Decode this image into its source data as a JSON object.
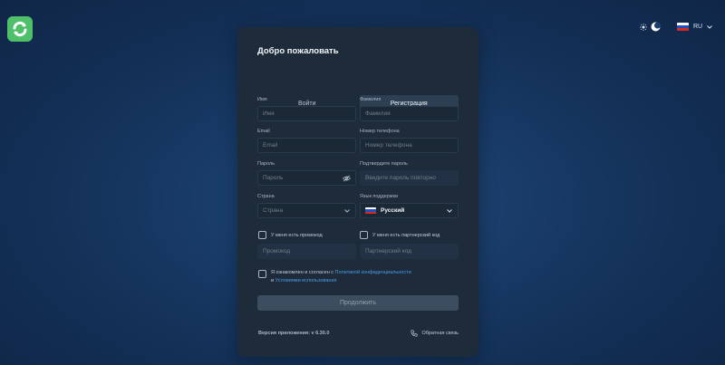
{
  "header": {
    "logo_icon": "refresh-arrows-logo",
    "brand_color": "#4fbf6a",
    "theme_icons": [
      "sun-icon",
      "moon-icon"
    ],
    "language": {
      "code": "RU",
      "flag": "russia-flag-icon"
    }
  },
  "card": {
    "title": "Добро пожаловать",
    "tabs": [
      {
        "label": "Войти",
        "active": false
      },
      {
        "label": "Регистрация",
        "active": true
      }
    ],
    "fields": {
      "first_name": {
        "label": "Имя",
        "placeholder": "Имя"
      },
      "last_name": {
        "label": "Фамилия",
        "placeholder": "Фамилия"
      },
      "email": {
        "label": "Email",
        "placeholder": "Email"
      },
      "phone": {
        "label": "Номер телефона",
        "placeholder": "Номер телефона"
      },
      "password": {
        "label": "Пароль",
        "placeholder": "Пароль"
      },
      "confirm_password": {
        "label": "Подтвердите пароль",
        "placeholder": "Введите пароль повторно"
      },
      "country": {
        "label": "Страна",
        "placeholder": "Страна"
      },
      "support_language": {
        "label": "Язык поддержки",
        "value": "Русский"
      }
    },
    "promo": {
      "checkbox_label": "У меня есть промокод",
      "placeholder": "Промокод"
    },
    "partner": {
      "checkbox_label": "У меня есть партнерский код",
      "placeholder": "Партнерский код"
    },
    "agreement": {
      "prefix": "Я ознакомлен и согласен с",
      "privacy_link": "Политикой конфиденциальности",
      "conjunction": "и",
      "terms_link": "Условиями использования"
    },
    "submit_label": "Продолжить",
    "version": "Версия приложения: v 6.30.0",
    "feedback_label": "Обратная связь",
    "link_color": "#4c9be6"
  }
}
